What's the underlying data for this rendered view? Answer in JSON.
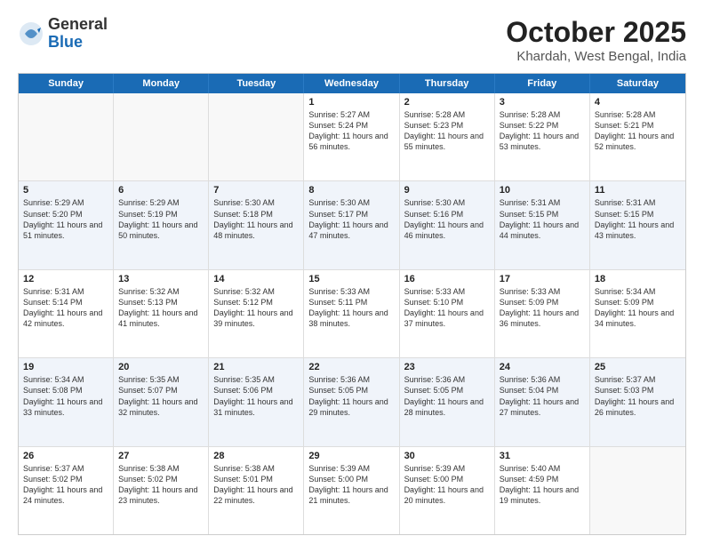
{
  "logo": {
    "general": "General",
    "blue": "Blue"
  },
  "title": {
    "month": "October 2025",
    "location": "Khardah, West Bengal, India"
  },
  "header_days": [
    "Sunday",
    "Monday",
    "Tuesday",
    "Wednesday",
    "Thursday",
    "Friday",
    "Saturday"
  ],
  "rows": [
    [
      {
        "day": "",
        "sunrise": "",
        "sunset": "",
        "daylight": "",
        "empty": true
      },
      {
        "day": "",
        "sunrise": "",
        "sunset": "",
        "daylight": "",
        "empty": true
      },
      {
        "day": "",
        "sunrise": "",
        "sunset": "",
        "daylight": "",
        "empty": true
      },
      {
        "day": "1",
        "sunrise": "Sunrise: 5:27 AM",
        "sunset": "Sunset: 5:24 PM",
        "daylight": "Daylight: 11 hours and 56 minutes."
      },
      {
        "day": "2",
        "sunrise": "Sunrise: 5:28 AM",
        "sunset": "Sunset: 5:23 PM",
        "daylight": "Daylight: 11 hours and 55 minutes."
      },
      {
        "day": "3",
        "sunrise": "Sunrise: 5:28 AM",
        "sunset": "Sunset: 5:22 PM",
        "daylight": "Daylight: 11 hours and 53 minutes."
      },
      {
        "day": "4",
        "sunrise": "Sunrise: 5:28 AM",
        "sunset": "Sunset: 5:21 PM",
        "daylight": "Daylight: 11 hours and 52 minutes."
      }
    ],
    [
      {
        "day": "5",
        "sunrise": "Sunrise: 5:29 AM",
        "sunset": "Sunset: 5:20 PM",
        "daylight": "Daylight: 11 hours and 51 minutes."
      },
      {
        "day": "6",
        "sunrise": "Sunrise: 5:29 AM",
        "sunset": "Sunset: 5:19 PM",
        "daylight": "Daylight: 11 hours and 50 minutes."
      },
      {
        "day": "7",
        "sunrise": "Sunrise: 5:30 AM",
        "sunset": "Sunset: 5:18 PM",
        "daylight": "Daylight: 11 hours and 48 minutes."
      },
      {
        "day": "8",
        "sunrise": "Sunrise: 5:30 AM",
        "sunset": "Sunset: 5:17 PM",
        "daylight": "Daylight: 11 hours and 47 minutes."
      },
      {
        "day": "9",
        "sunrise": "Sunrise: 5:30 AM",
        "sunset": "Sunset: 5:16 PM",
        "daylight": "Daylight: 11 hours and 46 minutes."
      },
      {
        "day": "10",
        "sunrise": "Sunrise: 5:31 AM",
        "sunset": "Sunset: 5:15 PM",
        "daylight": "Daylight: 11 hours and 44 minutes."
      },
      {
        "day": "11",
        "sunrise": "Sunrise: 5:31 AM",
        "sunset": "Sunset: 5:15 PM",
        "daylight": "Daylight: 11 hours and 43 minutes."
      }
    ],
    [
      {
        "day": "12",
        "sunrise": "Sunrise: 5:31 AM",
        "sunset": "Sunset: 5:14 PM",
        "daylight": "Daylight: 11 hours and 42 minutes."
      },
      {
        "day": "13",
        "sunrise": "Sunrise: 5:32 AM",
        "sunset": "Sunset: 5:13 PM",
        "daylight": "Daylight: 11 hours and 41 minutes."
      },
      {
        "day": "14",
        "sunrise": "Sunrise: 5:32 AM",
        "sunset": "Sunset: 5:12 PM",
        "daylight": "Daylight: 11 hours and 39 minutes."
      },
      {
        "day": "15",
        "sunrise": "Sunrise: 5:33 AM",
        "sunset": "Sunset: 5:11 PM",
        "daylight": "Daylight: 11 hours and 38 minutes."
      },
      {
        "day": "16",
        "sunrise": "Sunrise: 5:33 AM",
        "sunset": "Sunset: 5:10 PM",
        "daylight": "Daylight: 11 hours and 37 minutes."
      },
      {
        "day": "17",
        "sunrise": "Sunrise: 5:33 AM",
        "sunset": "Sunset: 5:09 PM",
        "daylight": "Daylight: 11 hours and 36 minutes."
      },
      {
        "day": "18",
        "sunrise": "Sunrise: 5:34 AM",
        "sunset": "Sunset: 5:09 PM",
        "daylight": "Daylight: 11 hours and 34 minutes."
      }
    ],
    [
      {
        "day": "19",
        "sunrise": "Sunrise: 5:34 AM",
        "sunset": "Sunset: 5:08 PM",
        "daylight": "Daylight: 11 hours and 33 minutes."
      },
      {
        "day": "20",
        "sunrise": "Sunrise: 5:35 AM",
        "sunset": "Sunset: 5:07 PM",
        "daylight": "Daylight: 11 hours and 32 minutes."
      },
      {
        "day": "21",
        "sunrise": "Sunrise: 5:35 AM",
        "sunset": "Sunset: 5:06 PM",
        "daylight": "Daylight: 11 hours and 31 minutes."
      },
      {
        "day": "22",
        "sunrise": "Sunrise: 5:36 AM",
        "sunset": "Sunset: 5:05 PM",
        "daylight": "Daylight: 11 hours and 29 minutes."
      },
      {
        "day": "23",
        "sunrise": "Sunrise: 5:36 AM",
        "sunset": "Sunset: 5:05 PM",
        "daylight": "Daylight: 11 hours and 28 minutes."
      },
      {
        "day": "24",
        "sunrise": "Sunrise: 5:36 AM",
        "sunset": "Sunset: 5:04 PM",
        "daylight": "Daylight: 11 hours and 27 minutes."
      },
      {
        "day": "25",
        "sunrise": "Sunrise: 5:37 AM",
        "sunset": "Sunset: 5:03 PM",
        "daylight": "Daylight: 11 hours and 26 minutes."
      }
    ],
    [
      {
        "day": "26",
        "sunrise": "Sunrise: 5:37 AM",
        "sunset": "Sunset: 5:02 PM",
        "daylight": "Daylight: 11 hours and 24 minutes."
      },
      {
        "day": "27",
        "sunrise": "Sunrise: 5:38 AM",
        "sunset": "Sunset: 5:02 PM",
        "daylight": "Daylight: 11 hours and 23 minutes."
      },
      {
        "day": "28",
        "sunrise": "Sunrise: 5:38 AM",
        "sunset": "Sunset: 5:01 PM",
        "daylight": "Daylight: 11 hours and 22 minutes."
      },
      {
        "day": "29",
        "sunrise": "Sunrise: 5:39 AM",
        "sunset": "Sunset: 5:00 PM",
        "daylight": "Daylight: 11 hours and 21 minutes."
      },
      {
        "day": "30",
        "sunrise": "Sunrise: 5:39 AM",
        "sunset": "Sunset: 5:00 PM",
        "daylight": "Daylight: 11 hours and 20 minutes."
      },
      {
        "day": "31",
        "sunrise": "Sunrise: 5:40 AM",
        "sunset": "Sunset: 4:59 PM",
        "daylight": "Daylight: 11 hours and 19 minutes."
      },
      {
        "day": "",
        "sunrise": "",
        "sunset": "",
        "daylight": "",
        "empty": true
      }
    ]
  ]
}
